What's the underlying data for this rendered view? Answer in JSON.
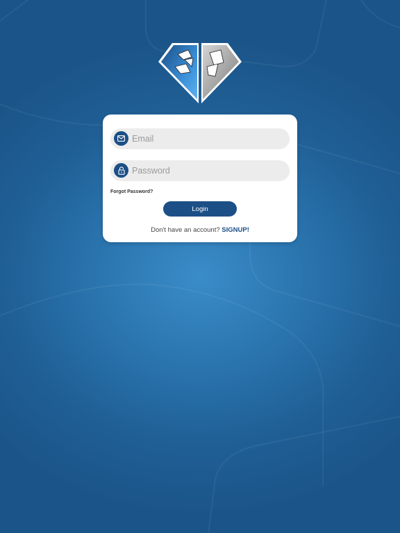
{
  "form": {
    "email_placeholder": "Email",
    "password_placeholder": "Password",
    "forgot_label": "Forgot Password?",
    "login_label": "Login"
  },
  "signup": {
    "prompt": "Don't have an account? ",
    "link_label": "SIGNUP!"
  },
  "icons": {
    "email": "mail-icon",
    "password": "lock-icon",
    "logo": "diamond-logo"
  },
  "colors": {
    "background": "#1f5f95",
    "accent": "#1c4f86",
    "card": "#ffffff",
    "field": "#ececec"
  }
}
